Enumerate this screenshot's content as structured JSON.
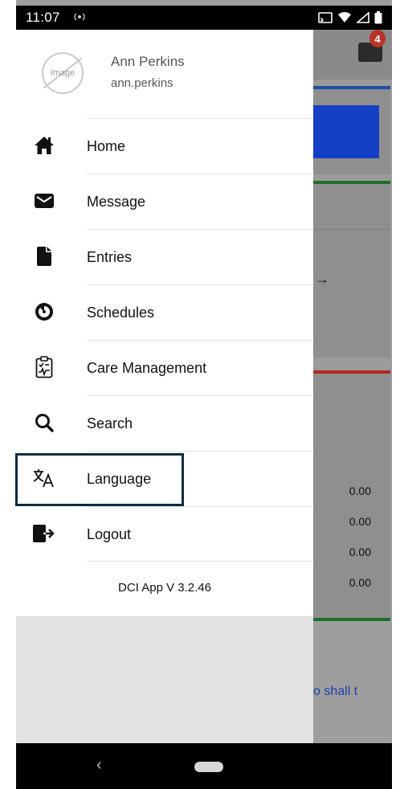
{
  "status_bar": {
    "time": "11:07",
    "notification_icon": "hotspot-icon"
  },
  "background": {
    "mail_badge_count": "4",
    "values": [
      "0.00",
      "0.00",
      "0.00",
      "0.00"
    ],
    "link_text": "o shall t"
  },
  "profile": {
    "avatar_placeholder": "Image",
    "name": "Ann Perkins",
    "username": "ann.perkins"
  },
  "menu": {
    "items": [
      {
        "label": "Home",
        "icon": "home-icon"
      },
      {
        "label": "Message",
        "icon": "envelope-icon"
      },
      {
        "label": "Entries",
        "icon": "document-icon"
      },
      {
        "label": "Schedules",
        "icon": "timer-icon"
      },
      {
        "label": "Care Management",
        "icon": "clipboard-icon"
      },
      {
        "label": "Search",
        "icon": "search-icon"
      },
      {
        "label": "Language",
        "icon": "translate-icon"
      },
      {
        "label": "Logout",
        "icon": "logout-icon"
      }
    ]
  },
  "app_version": "DCI App V 3.2.46",
  "nav_bar": {
    "back_glyph": "‹"
  },
  "colors": {
    "highlight_border": "#0e2c42",
    "badge": "#b8322a",
    "accent_blue": "#1340c4"
  }
}
